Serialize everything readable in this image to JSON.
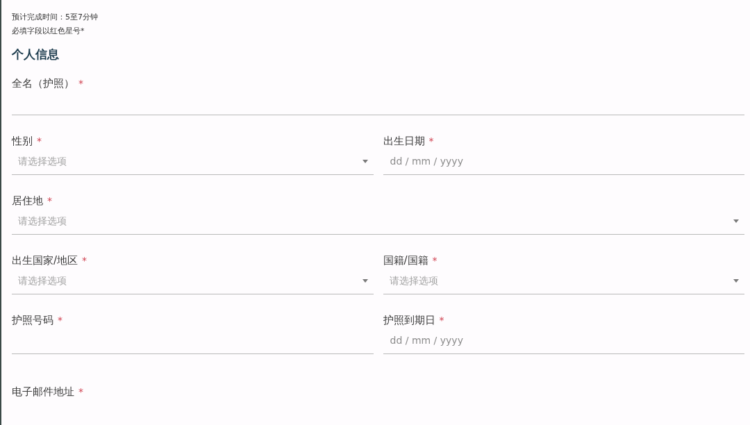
{
  "intro_lines": [
    "预计完成时间：5至7分钟",
    "必填字段以红色星号*"
  ],
  "required_mark": "*",
  "section": {
    "title": "个人信息",
    "rows": [
      {
        "fields": [
          {
            "label": "全名（护照）",
            "required": true,
            "kind": "text"
          }
        ]
      },
      {
        "fields": [
          {
            "label": "性别",
            "required": true,
            "kind": "select",
            "placeholder": "请选择选项"
          },
          {
            "label": "出生日期",
            "required": true,
            "kind": "date",
            "placeholder": "dd / mm / yyyy"
          }
        ]
      },
      {
        "fields": [
          {
            "label": "居住地",
            "required": true,
            "kind": "select",
            "placeholder": "请选择选项"
          }
        ]
      },
      {
        "fields": [
          {
            "label": "出生国家/地区",
            "required": true,
            "kind": "select",
            "placeholder": "请选择选项"
          },
          {
            "label": "国籍/国籍",
            "required": true,
            "kind": "select",
            "placeholder": "请选择选项"
          }
        ]
      },
      {
        "fields": [
          {
            "label": "护照号码",
            "required": true,
            "kind": "text"
          },
          {
            "label": "护照到期日",
            "required": true,
            "kind": "date",
            "placeholder": "dd / mm / yyyy"
          }
        ]
      },
      {
        "fields": [
          {
            "label": "电子邮件地址",
            "required": true
          }
        ]
      }
    ]
  }
}
